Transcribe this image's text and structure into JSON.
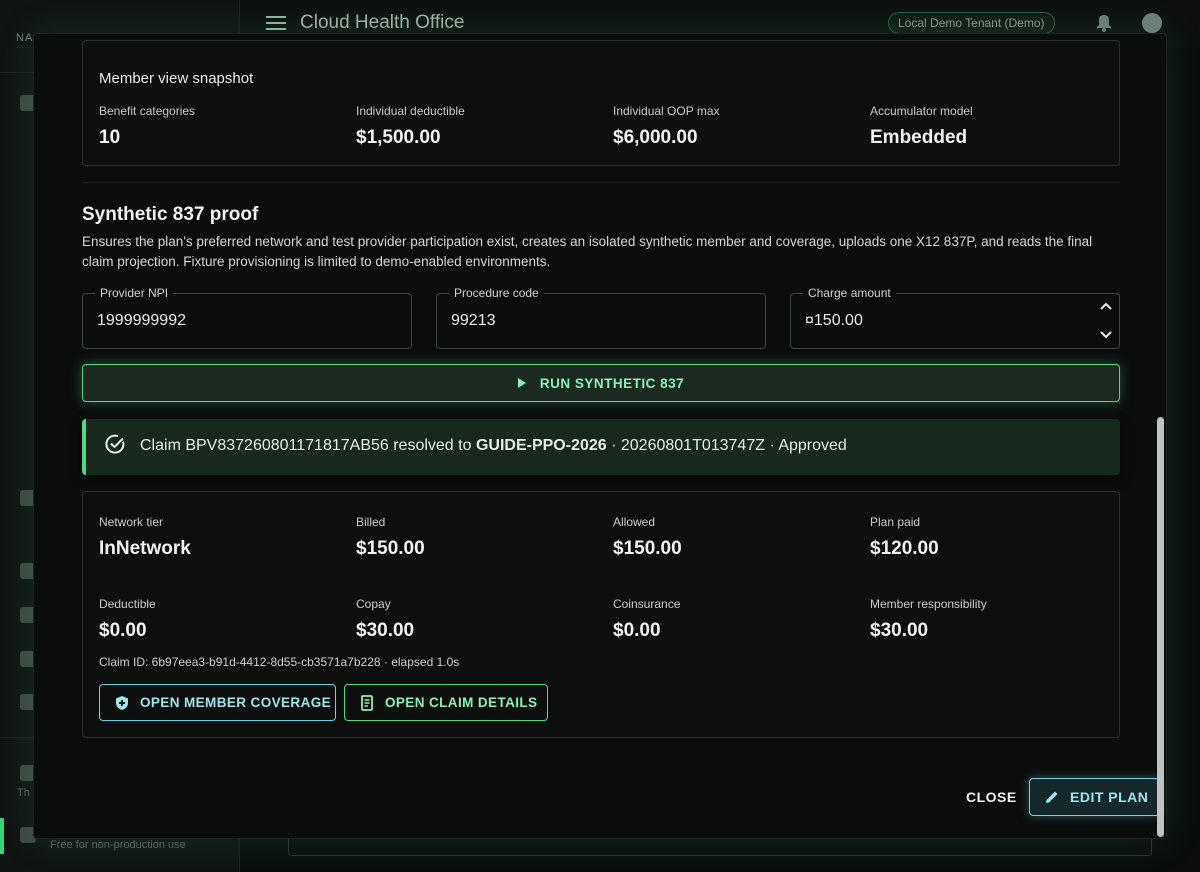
{
  "app": {
    "title": "Cloud Health Office",
    "tenant": "Local Demo Tenant (Demo)",
    "nav_label": "NA",
    "sidebar_th": "Th",
    "sidebar_footer": "Free for non-production use"
  },
  "snapshot": {
    "heading": "Member view snapshot",
    "stats": [
      {
        "label": "Benefit categories",
        "value": "10"
      },
      {
        "label": "Individual deductible",
        "value": "$1,500.00"
      },
      {
        "label": "Individual OOP max",
        "value": "$6,000.00"
      },
      {
        "label": "Accumulator model",
        "value": "Embedded"
      }
    ]
  },
  "proof": {
    "title": "Synthetic 837 proof",
    "description": "Ensures the plan's preferred network and test provider participation exist, creates an isolated synthetic member and coverage, uploads one X12 837P, and reads the final claim projection. Fixture provisioning is limited to demo-enabled environments.",
    "fields": {
      "npi": {
        "label": "Provider NPI",
        "value": "1999999992"
      },
      "procedure": {
        "label": "Procedure code",
        "value": "99213"
      },
      "charge": {
        "label": "Charge amount",
        "value": "¤150.00"
      }
    },
    "run_label": "RUN SYNTHETIC 837"
  },
  "alert": {
    "prefix": "Claim BPV837260801171817AB56 resolved to ",
    "plan": "GUIDE-PPO-2026",
    "suffix": " · 20260801T013747Z · Approved"
  },
  "result": {
    "stats": [
      {
        "label": "Network tier",
        "value": "InNetwork"
      },
      {
        "label": "Billed",
        "value": "$150.00"
      },
      {
        "label": "Allowed",
        "value": "$150.00"
      },
      {
        "label": "Plan paid",
        "value": "$120.00"
      },
      {
        "label": "Deductible",
        "value": "$0.00"
      },
      {
        "label": "Copay",
        "value": "$30.00"
      },
      {
        "label": "Coinsurance",
        "value": "$0.00"
      },
      {
        "label": "Member responsibility",
        "value": "$30.00"
      }
    ],
    "claim_meta": "Claim ID: 6b97eea3-b91d-4412-8d55-cb3571a7b228 · elapsed 1.0s",
    "open_coverage": "OPEN MEMBER COVERAGE",
    "open_claim": "OPEN CLAIM DETAILS"
  },
  "actions": {
    "close": "CLOSE",
    "edit": "EDIT PLAN"
  },
  "colors": {
    "accent_green": "#4fd987",
    "accent_cyan": "#6cd3df",
    "background": "#0b0d0c"
  }
}
